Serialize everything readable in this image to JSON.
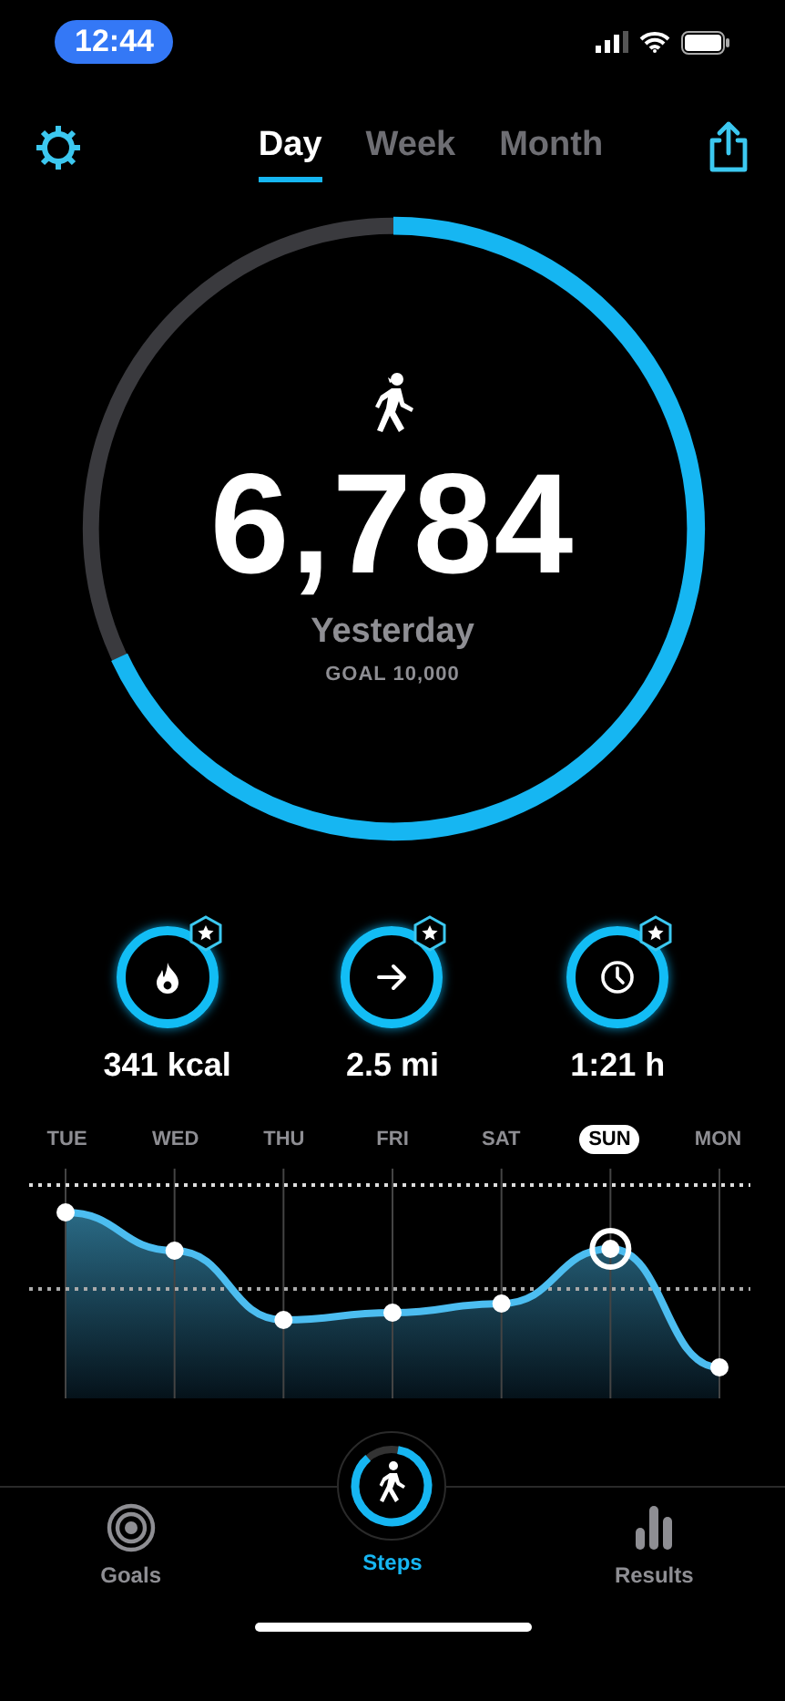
{
  "status_bar": {
    "time": "12:44"
  },
  "tabs": [
    {
      "label": "Day",
      "selected": true
    },
    {
      "label": "Week",
      "selected": false
    },
    {
      "label": "Month",
      "selected": false
    }
  ],
  "summary": {
    "count": "6,784",
    "period": "Yesterday",
    "goal": "GOAL 10,000",
    "level": 0.68
  },
  "metrics": [
    {
      "kind": "calories",
      "value": "341 kcal"
    },
    {
      "kind": "distance",
      "value": "2.5 mi"
    },
    {
      "kind": "duration",
      "value": "1:21 h"
    }
  ],
  "days": [
    {
      "label": "TUE",
      "selected": false
    },
    {
      "label": "WED",
      "selected": false
    },
    {
      "label": "THU",
      "selected": false
    },
    {
      "label": "FRI",
      "selected": false
    },
    {
      "label": "SAT",
      "selected": false
    },
    {
      "label": "SUN",
      "selected": true
    },
    {
      "label": "MON",
      "selected": false
    }
  ],
  "bottom_nav": [
    {
      "kind": "goals",
      "label": "Goals",
      "selected": false
    },
    {
      "kind": "steps",
      "label": "Steps",
      "selected": true
    },
    {
      "kind": "results",
      "label": "Results",
      "selected": false
    }
  ]
}
